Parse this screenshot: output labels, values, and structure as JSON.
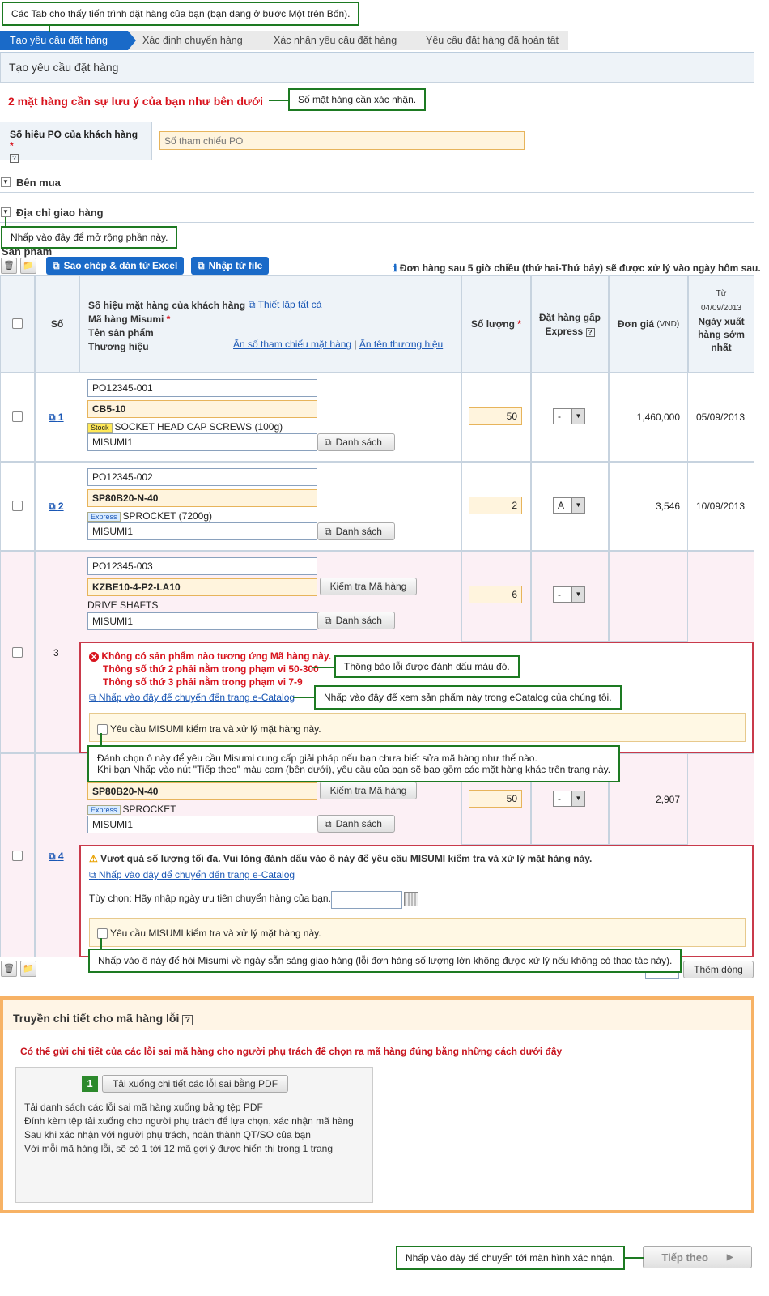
{
  "callouts": {
    "tabs": "Các Tab cho thấy tiến trình đặt hàng của bạn (bạn đang ở bước Một trên Bốn).",
    "count": "Số mặt hàng cần xác nhận.",
    "expand": "Nhấp vào đây để mở rộng phần này.",
    "error": "Thông báo lỗi được đánh dấu màu đỏ.",
    "ecatalog": "Nhấp vào đây để xem sản phẩm này trong eCatalog của chúng tôi.",
    "check_line1": "Đánh chọn ô này để yêu cầu Misumi cung cấp giải pháp nếu bạn chưa biết sửa mã hàng như thế nào.",
    "check_line2": "Khi bạn Nhấp vào nút \"Tiếp theo\" màu cam  (bên dưới), yêu cầu của bạn sẽ bao gồm các mặt hàng khác trên trang này.",
    "date": "Nhấp vào ô này để hỏi Misumi về ngày sẵn sàng giao hàng (lỗi đơn hàng số lượng lớn không được xử lý nếu không có thao tác này).",
    "next": "Nhấp vào đây để chuyển tới màn hình xác nhận."
  },
  "steps": [
    "Tạo yêu cầu đặt hàng",
    "Xác định chuyển hàng",
    "Xác nhận yêu cầu đặt hàng",
    "Yêu cầu đặt hàng đã hoàn tất"
  ],
  "page_title": "Tạo yêu cầu đặt hàng",
  "warning_title": "2 mặt hàng cần sự lưu ý của bạn như bên dưới",
  "po": {
    "label": "Số hiệu PO của khách hàng",
    "req": "*",
    "placeholder": "Số tham chiếu PO"
  },
  "buyer": "Bên mua",
  "shipping": "Địa chỉ giao hàng",
  "products": "Sản phẩm",
  "toolbar": {
    "copy_excel": "Sao chép & dán từ Excel",
    "import": "Nhập từ file",
    "notice": "Đơn hàng sau 5 giờ chiều (thứ hai-Thứ bảy) sẽ được xử lý vào ngày hôm sau."
  },
  "header": {
    "no": "Số",
    "cust_part": "Số hiệu mặt hàng của khách hàng",
    "set_all": "Thiết lập tất cả",
    "misumi_code": "Mã hàng Misumi",
    "product_name": "Tên sản phẩm",
    "brand": "Thương hiệu",
    "hide_ref": "Ẩn số tham chiếu mặt hàng",
    "hide_brand": "Ẩn tên thương hiệu",
    "qty": "Số lượng",
    "express": "Đặt hàng gấp Express",
    "price": "Đơn giá",
    "price_unit": "(VND)",
    "from": "Từ",
    "from_date": "04/09/2013",
    "ship": "Ngày xuất hàng sớm nhất"
  },
  "rows": [
    {
      "no": "1",
      "ref": "PO12345-001",
      "code": "CB5-10",
      "badge": "Stock",
      "name": "SOCKET HEAD CAP SCREWS (100g)",
      "brand": "MISUMI1",
      "list": "Danh sách",
      "qty": "50",
      "express": "-",
      "price": "1,460,000",
      "date": "05/09/2013"
    },
    {
      "no": "2",
      "ref": "PO12345-002",
      "code": "SP80B20-N-40",
      "badge": "Express",
      "name": "SPROCKET (7200g)",
      "brand": "MISUMI1",
      "list": "Danh sách",
      "qty": "2",
      "express": "A",
      "price": "3,546",
      "date": "10/09/2013"
    },
    {
      "no": "3",
      "ref": "PO12345-003",
      "code": "KZBE10-4-P2-LA10",
      "check": "Kiểm tra Mã hàng",
      "name": "DRIVE SHAFTS",
      "brand": "MISUMI1",
      "list": "Danh sách",
      "qty": "6",
      "express": "-"
    },
    {
      "no": "4",
      "code": "SP80B20-N-40",
      "check": "Kiểm tra Mã hàng",
      "badge": "Express",
      "name": "SPROCKET",
      "brand": "MISUMI1",
      "list": "Danh sách",
      "qty": "50",
      "express": "-",
      "price": "2,907"
    }
  ],
  "err3": {
    "title": "Không có sản phẩm nào tương ứng Mã hàng này.",
    "line1": "Thông số thứ 2 phải nằm trong phạm vi 50-300",
    "line2": "Thông số thứ 3 phải nằm trong phạm vi 7-9",
    "link": "Nhấp vào đây để chuyển đến trang e-Catalog",
    "request": "Yêu cầu MISUMI kiểm tra và xử lý mặt hàng này."
  },
  "err4": {
    "title": "Vượt quá số lượng tối đa. Vui lòng đánh dấu vào ô này để yêu cầu MISUMI kiểm tra và xử lý mặt hàng này.",
    "link": "Nhấp vào đây để chuyển đến trang e-Catalog",
    "option": "Tùy chọn: Hãy nhập ngày ưu tiên chuyển hàng của bạn.",
    "request": "Yêu cầu MISUMI kiểm tra và xử lý mặt hàng này."
  },
  "add_row": "Thêm dòng",
  "detail": {
    "title": "Truyền chi tiết cho mã hàng lỗi",
    "help": "?",
    "subtitle": "Có thể gửi chi tiết của các lỗi sai mã hàng cho người phụ trách để chọn ra mã hàng đúng bằng những cách dưới đây",
    "step_no": "1",
    "download": "Tải xuống chi tiết các lỗi sai bằng PDF",
    "lines": [
      "Tải danh sách các lỗi sai mã hàng xuống bằng tệp PDF",
      "Đính kèm tệp tải xuống cho người phụ trách để lựa chọn, xác nhận mã hàng",
      "Sau khi xác nhận với người phụ trách, hoàn thành QT/SO của bạn",
      "Với mỗi mã hàng lỗi, sẽ có 1 tới 12 mã gợi ý được hiển thị trong 1 trang"
    ]
  },
  "next_button": "Tiếp theo",
  "help_q": "?",
  "colors": {
    "accent": "#1a6ac8",
    "error": "#d8141e",
    "callout": "#1d7a22",
    "frame": "#f7b265"
  }
}
